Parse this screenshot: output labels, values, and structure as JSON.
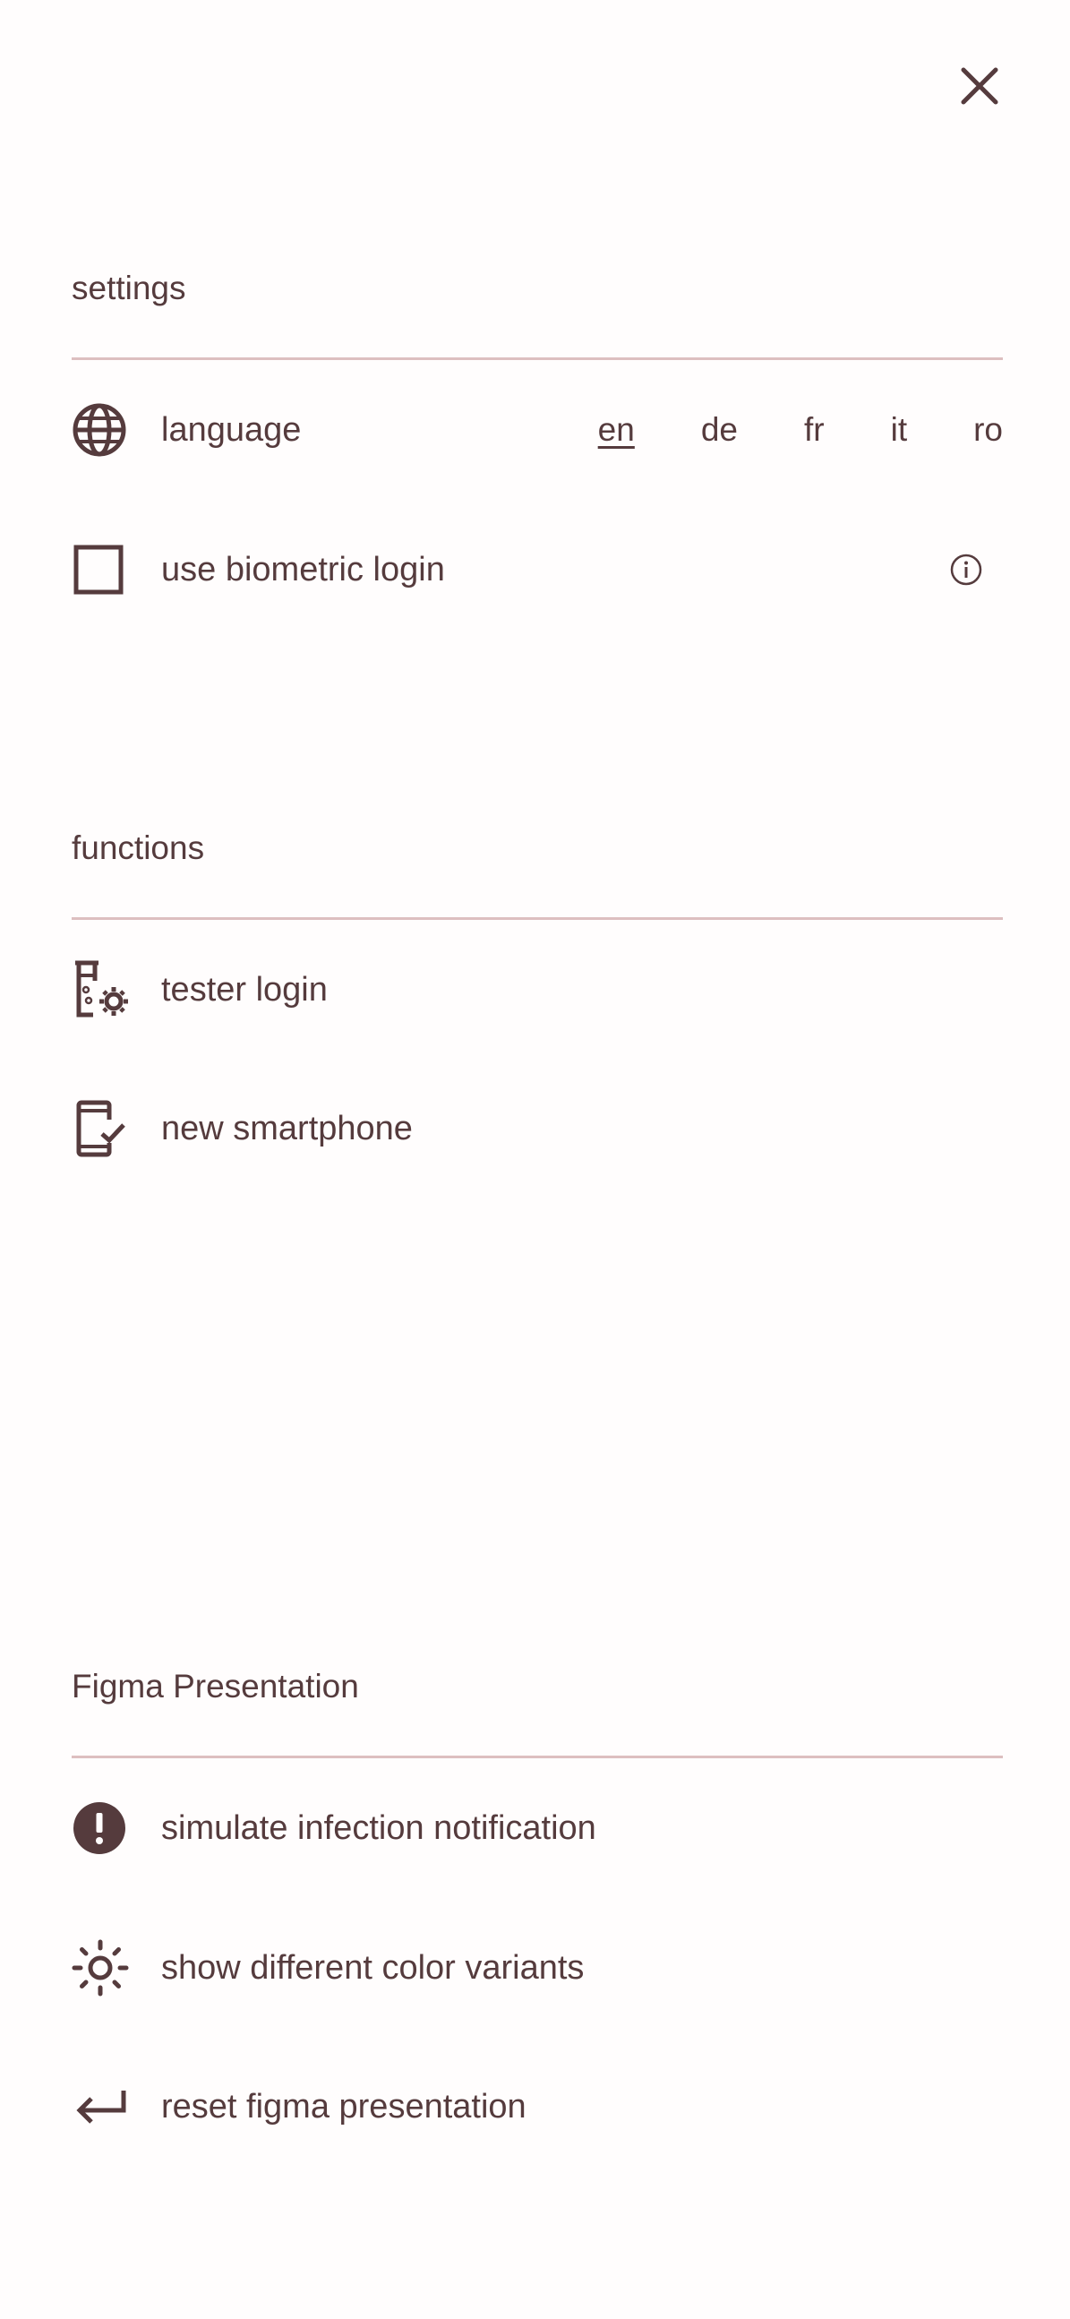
{
  "close": {
    "icon": "close-icon"
  },
  "settings": {
    "title": "settings",
    "language": {
      "label": "language",
      "icon": "globe-icon",
      "options": [
        "en",
        "de",
        "fr",
        "it",
        "ro"
      ],
      "selected": "en"
    },
    "biometric": {
      "label": "use biometric login",
      "checked": false,
      "info_icon": "info-icon"
    }
  },
  "functions": {
    "title": "functions",
    "items": [
      {
        "label": "tester login",
        "icon": "test-tube-gear-icon"
      },
      {
        "label": "new smartphone",
        "icon": "smartphone-check-icon"
      }
    ]
  },
  "figma": {
    "title": "Figma Presentation",
    "items": [
      {
        "label": "simulate infection notification",
        "icon": "alert-circle-icon"
      },
      {
        "label": "show different color variants",
        "icon": "sun-icon"
      },
      {
        "label": "reset figma presentation",
        "icon": "return-arrow-icon"
      }
    ]
  },
  "colors": {
    "text": "#553b3d",
    "divider": "#ddbfc0",
    "background": "#fffdfd"
  }
}
